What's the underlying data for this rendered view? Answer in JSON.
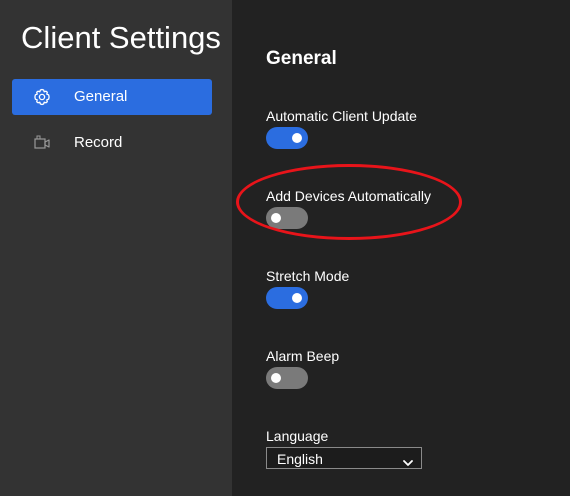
{
  "app": {
    "title": "Client Settings"
  },
  "sidebar": {
    "items": [
      {
        "label": "General",
        "icon": "gear-icon",
        "active": true
      },
      {
        "label": "Record",
        "icon": "video-camera-icon",
        "active": false
      }
    ]
  },
  "main": {
    "section_title": "General",
    "settings": [
      {
        "label": "Automatic Client Update",
        "type": "toggle",
        "value": true
      },
      {
        "label": "Add Devices Automatically",
        "type": "toggle",
        "value": false
      },
      {
        "label": "Stretch Mode",
        "type": "toggle",
        "value": true
      },
      {
        "label": "Alarm Beep",
        "type": "toggle",
        "value": false
      }
    ],
    "language": {
      "label": "Language",
      "selected": "English"
    }
  },
  "annotation": {
    "shape": "ellipse",
    "color": "#e8141a",
    "target": "Add Devices Automatically"
  },
  "colors": {
    "accent": "#2b6de0",
    "sidebar_bg": "#333333",
    "main_bg": "#222222",
    "toggle_off": "#7a7a7a",
    "annotation": "#e8141a"
  }
}
